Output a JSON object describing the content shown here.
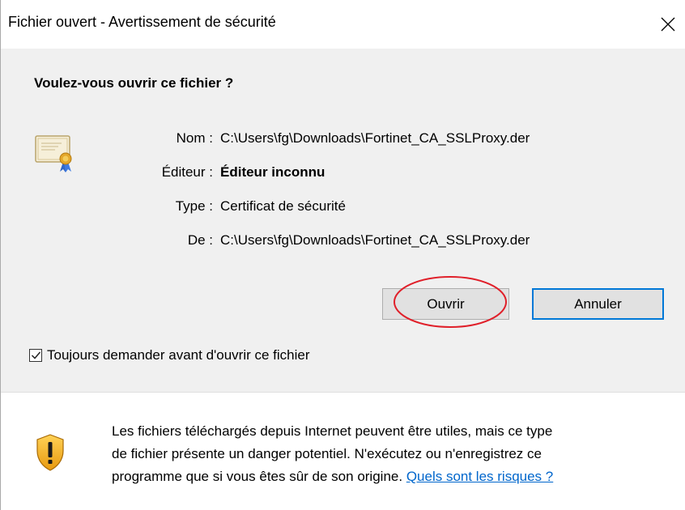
{
  "window": {
    "title": "Fichier ouvert - Avertissement de sécurité",
    "close_icon": "close-icon"
  },
  "question": "Voulez-vous ouvrir ce fichier ?",
  "file_icon": "certificate-icon",
  "details": [
    {
      "label": "Nom :",
      "value": "C:\\Users\\fg\\Downloads\\Fortinet_CA_SSLProxy.der"
    },
    {
      "label": "Éditeur :",
      "value": "Éditeur inconnu"
    },
    {
      "label": "Type :",
      "value": "Certificat de sécurité"
    },
    {
      "label": "De :",
      "value": "C:\\Users\\fg\\Downloads\\Fortinet_CA_SSLProxy.der"
    }
  ],
  "buttons": {
    "open_label": "Ouvrir",
    "cancel_label": "Annuler"
  },
  "annotation_color": "#e0202a",
  "checkbox": {
    "label": "Toujours demander avant d'ouvrir ce fichier",
    "checked": true
  },
  "warning": {
    "icon": "shield-warning-icon",
    "line1": "Les fichiers téléchargés depuis Internet peuvent être utiles, mais ce type",
    "line2": "de fichier présente un danger potentiel. N'exécutez ou n'enregistrez ce",
    "line3": "programme que si vous êtes sûr de son origine. ",
    "link": "Quels sont les risques ?"
  },
  "colors": {
    "accent": "#0078d7",
    "link": "#0066cc",
    "content_bg": "#f0f0f0"
  }
}
